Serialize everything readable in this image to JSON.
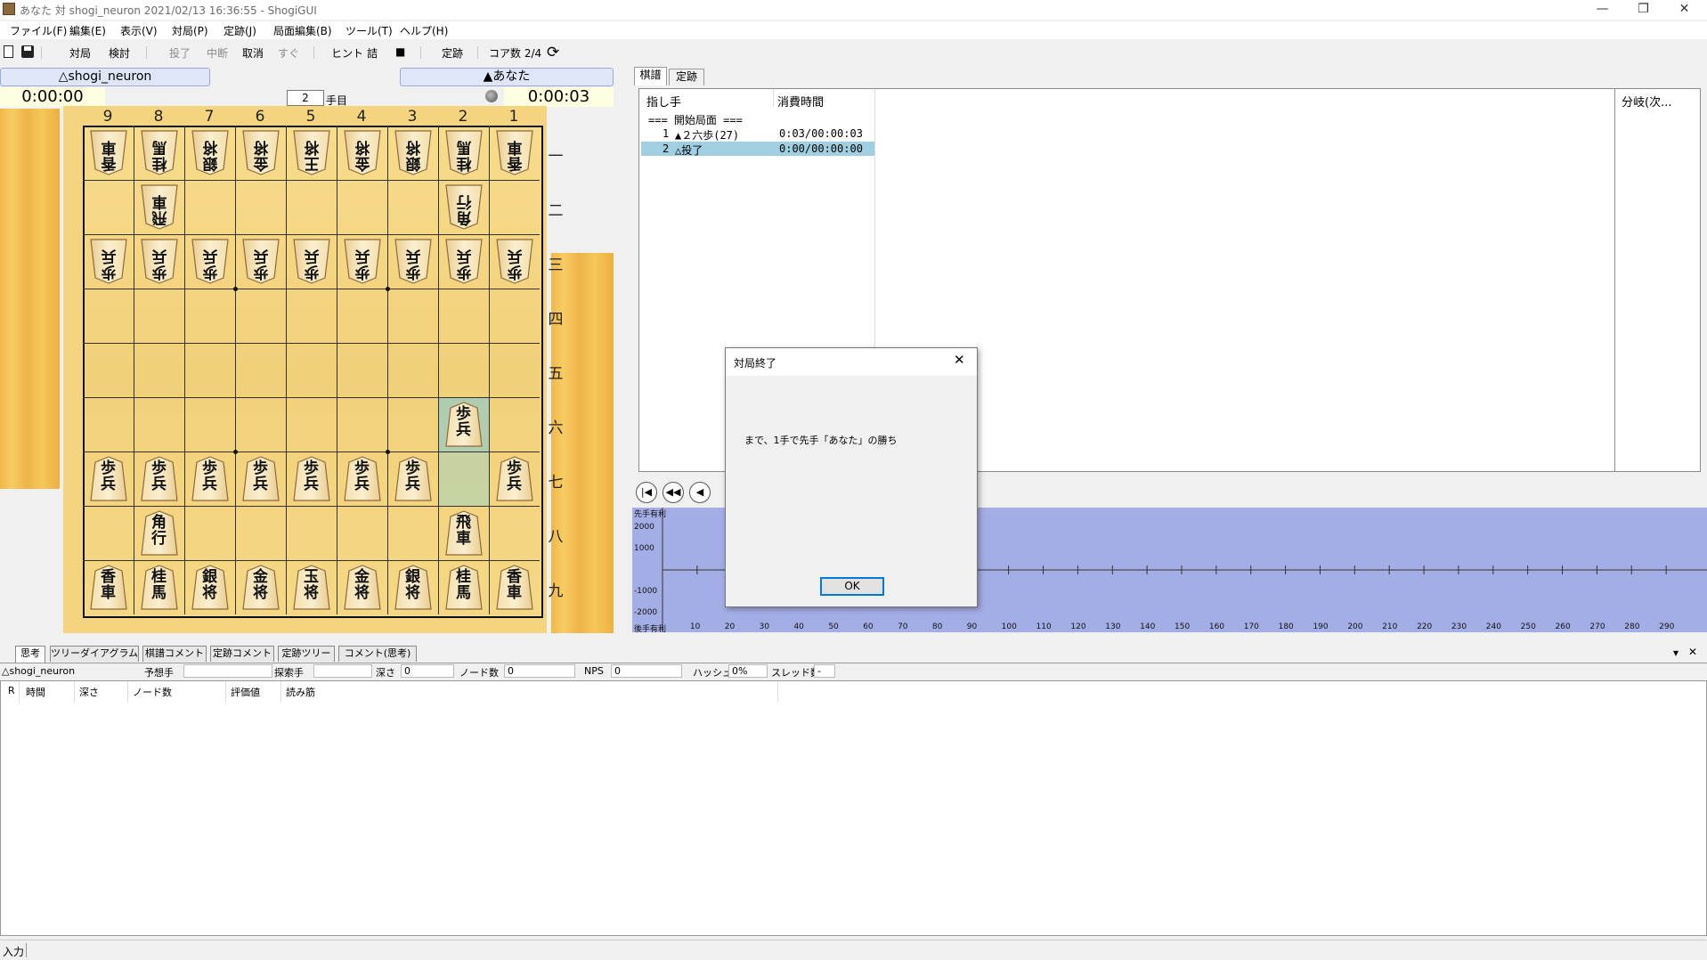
{
  "window": {
    "title": "あなた 対 shogi_neuron 2021/02/13 16:36:55 - ShogiGUI",
    "minimize": "—",
    "restore": "❐",
    "close": "✕"
  },
  "menubar": [
    "ファイル(F)",
    "編集(E)",
    "表示(V)",
    "対局(P)",
    "定跡(J)",
    "局面編集(B)",
    "ツール(T)",
    "ヘルプ(H)"
  ],
  "toolbar": {
    "taikyoku": "対局",
    "kento": "検討",
    "toryo": "投了",
    "chudan": "中断",
    "torikeshi": "取消",
    "sugu": "すぐ",
    "hint": "ヒント",
    "tsume": "詰",
    "stop": "■",
    "joseki": "定跡",
    "cores": "コア数 2/4"
  },
  "players": {
    "gote_name": "△shogi_neuron",
    "sente_name": "▲あなた",
    "gote_clock": "0:00:00",
    "sente_clock": "0:00:03",
    "move_no": "2",
    "move_suffix": "手目"
  },
  "board": {
    "files": [
      "9",
      "8",
      "7",
      "6",
      "5",
      "4",
      "3",
      "2",
      "1"
    ],
    "ranks": [
      "一",
      "二",
      "三",
      "四",
      "五",
      "六",
      "七",
      "八",
      "九"
    ],
    "pieces": [
      {
        "col": 0,
        "row": 0,
        "label": "香\n車",
        "side": "gote"
      },
      {
        "col": 1,
        "row": 0,
        "label": "桂\n馬",
        "side": "gote"
      },
      {
        "col": 2,
        "row": 0,
        "label": "銀\n将",
        "side": "gote"
      },
      {
        "col": 3,
        "row": 0,
        "label": "金\n将",
        "side": "gote"
      },
      {
        "col": 4,
        "row": 0,
        "label": "王\n将",
        "side": "gote"
      },
      {
        "col": 5,
        "row": 0,
        "label": "金\n将",
        "side": "gote"
      },
      {
        "col": 6,
        "row": 0,
        "label": "銀\n将",
        "side": "gote"
      },
      {
        "col": 7,
        "row": 0,
        "label": "桂\n馬",
        "side": "gote"
      },
      {
        "col": 8,
        "row": 0,
        "label": "香\n車",
        "side": "gote"
      },
      {
        "col": 1,
        "row": 1,
        "label": "飛\n車",
        "side": "gote"
      },
      {
        "col": 7,
        "row": 1,
        "label": "角\n行",
        "side": "gote"
      },
      {
        "col": 0,
        "row": 2,
        "label": "歩\n兵",
        "side": "gote"
      },
      {
        "col": 1,
        "row": 2,
        "label": "歩\n兵",
        "side": "gote"
      },
      {
        "col": 2,
        "row": 2,
        "label": "歩\n兵",
        "side": "gote"
      },
      {
        "col": 3,
        "row": 2,
        "label": "歩\n兵",
        "side": "gote"
      },
      {
        "col": 4,
        "row": 2,
        "label": "歩\n兵",
        "side": "gote"
      },
      {
        "col": 5,
        "row": 2,
        "label": "歩\n兵",
        "side": "gote"
      },
      {
        "col": 6,
        "row": 2,
        "label": "歩\n兵",
        "side": "gote"
      },
      {
        "col": 7,
        "row": 2,
        "label": "歩\n兵",
        "side": "gote"
      },
      {
        "col": 8,
        "row": 2,
        "label": "歩\n兵",
        "side": "gote"
      },
      {
        "col": 7,
        "row": 5,
        "label": "歩\n兵",
        "side": "sente"
      },
      {
        "col": 0,
        "row": 6,
        "label": "歩\n兵",
        "side": "sente"
      },
      {
        "col": 1,
        "row": 6,
        "label": "歩\n兵",
        "side": "sente"
      },
      {
        "col": 2,
        "row": 6,
        "label": "歩\n兵",
        "side": "sente"
      },
      {
        "col": 3,
        "row": 6,
        "label": "歩\n兵",
        "side": "sente"
      },
      {
        "col": 4,
        "row": 6,
        "label": "歩\n兵",
        "side": "sente"
      },
      {
        "col": 5,
        "row": 6,
        "label": "歩\n兵",
        "side": "sente"
      },
      {
        "col": 6,
        "row": 6,
        "label": "歩\n兵",
        "side": "sente"
      },
      {
        "col": 8,
        "row": 6,
        "label": "歩\n兵",
        "side": "sente"
      },
      {
        "col": 1,
        "row": 7,
        "label": "角\n行",
        "side": "sente"
      },
      {
        "col": 7,
        "row": 7,
        "label": "飛\n車",
        "side": "sente"
      },
      {
        "col": 0,
        "row": 8,
        "label": "香\n車",
        "side": "sente"
      },
      {
        "col": 1,
        "row": 8,
        "label": "桂\n馬",
        "side": "sente"
      },
      {
        "col": 2,
        "row": 8,
        "label": "銀\n将",
        "side": "sente"
      },
      {
        "col": 3,
        "row": 8,
        "label": "金\n将",
        "side": "sente"
      },
      {
        "col": 4,
        "row": 8,
        "label": "玉\n将",
        "side": "sente"
      },
      {
        "col": 5,
        "row": 8,
        "label": "金\n将",
        "side": "sente"
      },
      {
        "col": 6,
        "row": 8,
        "label": "銀\n将",
        "side": "sente"
      },
      {
        "col": 7,
        "row": 8,
        "label": "桂\n馬",
        "side": "sente"
      },
      {
        "col": 8,
        "row": 8,
        "label": "香\n車",
        "side": "sente"
      }
    ]
  },
  "kifu": {
    "tabs": [
      "棋譜",
      "定跡"
    ],
    "col_move": "指し手",
    "col_time": "消費時間",
    "col_branch": "分岐(次...",
    "header_line": "=== 開始局面 ===",
    "rows": [
      {
        "no": "1",
        "move": "▲２六歩(27)",
        "time": "0:03/00:00:03"
      },
      {
        "no": "2",
        "move": "△投了",
        "time": "0:00/00:00:00"
      }
    ]
  },
  "graph": {
    "label_sente": "先手有利",
    "label_gote": "後手有利",
    "y_ticks": [
      "2000",
      "1000",
      "-1000",
      "-2000"
    ],
    "x_ticks": [
      "10",
      "20",
      "30",
      "40",
      "50",
      "60",
      "70",
      "80",
      "90",
      "100",
      "110",
      "120",
      "130",
      "140",
      "150",
      "160",
      "170",
      "180",
      "190",
      "200",
      "210",
      "220",
      "230",
      "240",
      "250",
      "260",
      "270",
      "280",
      "290"
    ]
  },
  "dialog": {
    "title": "対局終了",
    "message": "まで、1手で先手「あなた」の勝ち",
    "ok": "OK"
  },
  "bottom": {
    "tabs": [
      "思考",
      "ツリーダイアグラム",
      "棋譜コメント",
      "定跡コメント",
      "定跡ツリー",
      "コメント(思考)"
    ],
    "engine": "△shogi_neuron",
    "yosou": "予想手",
    "tansaku": "探索手",
    "fukasa": "深さ",
    "fukasa_val": "0",
    "node": "ノード数",
    "node_val": "0",
    "nps": "NPS",
    "nps_val": "0",
    "hash": "ハッシュ",
    "hash_val": "0%",
    "thread": "スレッド数",
    "thread_val": "-",
    "col_r": "R",
    "col_time": "時間",
    "col_depth": "深さ",
    "col_nodes": "ノード数",
    "col_eval": "評価値",
    "col_pv": "読み筋",
    "collapse": "▾",
    "close": "✕"
  },
  "status": "入力"
}
